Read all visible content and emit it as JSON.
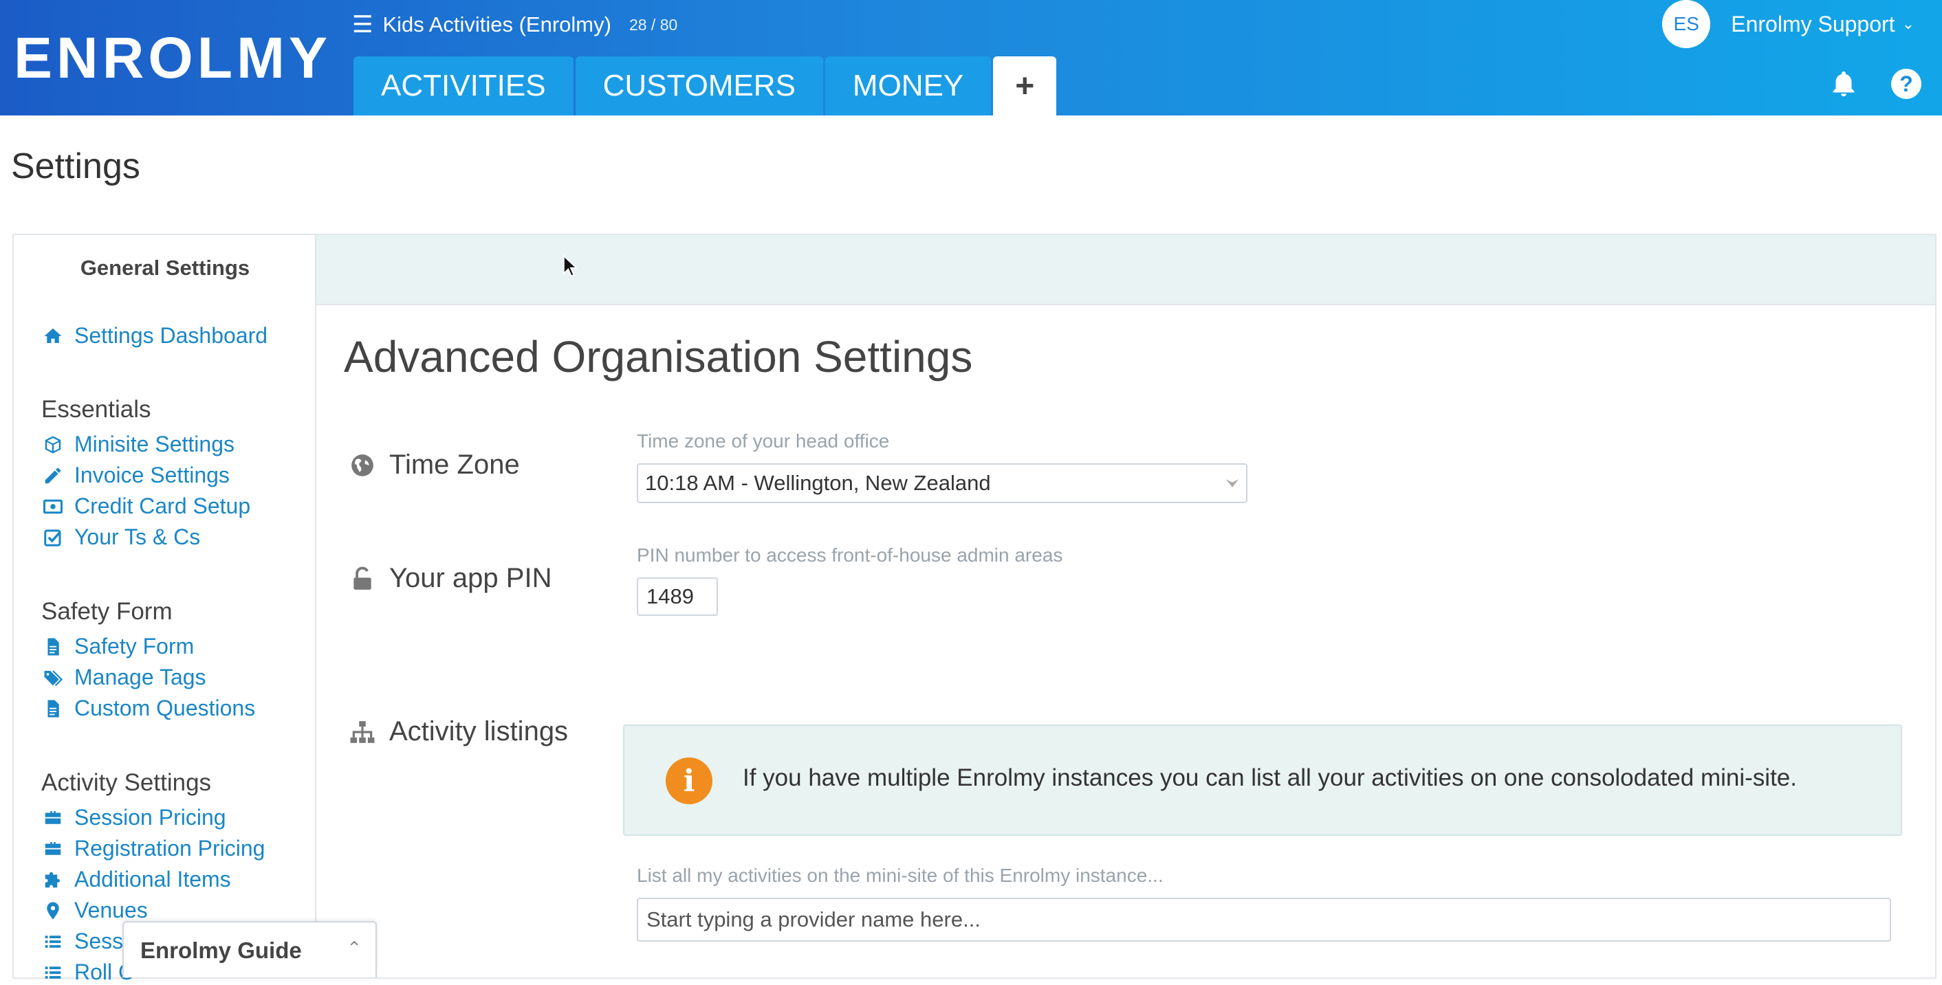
{
  "header": {
    "logo_text": "ENROLMY",
    "instance_name": "Kids Activities (Enrolmy)",
    "instance_count": "28 / 80",
    "tabs": [
      {
        "label": "ACTIVITIES"
      },
      {
        "label": "CUSTOMERS"
      },
      {
        "label": "MONEY"
      },
      {
        "label": "+"
      }
    ],
    "user_initials": "ES",
    "user_name": "Enrolmy Support"
  },
  "page_title": "Settings",
  "sidebar": {
    "title": "General Settings",
    "dashboard_link": "Settings Dashboard",
    "groups": [
      {
        "title": "Essentials",
        "items": [
          "Minisite Settings",
          "Invoice Settings",
          "Credit Card Setup",
          "Your Ts & Cs"
        ]
      },
      {
        "title": "Safety Form",
        "items": [
          "Safety Form",
          "Manage Tags",
          "Custom Questions"
        ]
      },
      {
        "title": "Activity Settings",
        "items": [
          "Session Pricing",
          "Registration Pricing",
          "Additional Items",
          "Venues",
          "Sessi",
          "Roll C"
        ]
      }
    ]
  },
  "content": {
    "section_title": "Advanced Organisation Settings",
    "timezone": {
      "label": "Time Zone",
      "help": "Time zone of your head office",
      "value": "10:18 AM - Wellington, New Zealand"
    },
    "pin": {
      "label": "Your app PIN",
      "help": "PIN number to access front-of-house admin areas",
      "value": "1489"
    },
    "listings": {
      "label": "Activity listings",
      "info_text": "If you have multiple Enrolmy instances you can list all your activities on one consolodated mini-site.",
      "help": "List all my activities on the mini-site of this Enrolmy instance...",
      "placeholder": "Start typing a provider name here..."
    }
  },
  "guide": {
    "title": "Enrolmy Guide"
  },
  "colors": {
    "header_start": "#1b5cc7",
    "header_end": "#12a6e8",
    "link": "#1a86c7",
    "info_bg": "#e8f3f2",
    "info_icon": "#f08d1e"
  }
}
